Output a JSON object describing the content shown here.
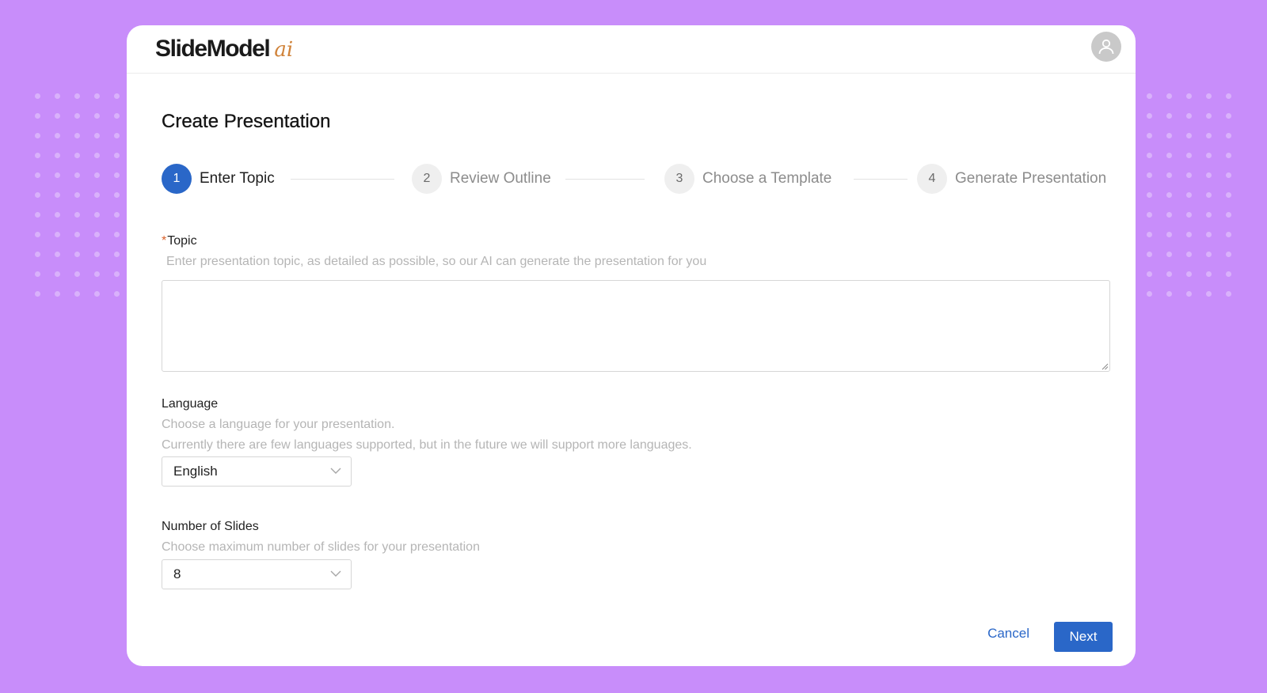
{
  "brand": {
    "name": "SlideModel",
    "suffix": "ai"
  },
  "page": {
    "title": "Create Presentation"
  },
  "stepper": {
    "steps": [
      {
        "number": "1",
        "label": "Enter Topic",
        "active": true
      },
      {
        "number": "2",
        "label": "Review Outline",
        "active": false
      },
      {
        "number": "3",
        "label": "Choose a Template",
        "active": false
      },
      {
        "number": "4",
        "label": "Generate Presentation",
        "active": false
      }
    ]
  },
  "form": {
    "topic": {
      "required_mark": "*",
      "label": "Topic",
      "help": "Enter presentation topic, as detailed as possible, so our AI can generate the presentation for you",
      "value": ""
    },
    "language": {
      "label": "Language",
      "help_line1": "Choose a language for your presentation.",
      "help_line2": "Currently there are few languages supported, but in the future we will support more languages.",
      "selected": "English"
    },
    "slides": {
      "label": "Number of Slides",
      "help": "Choose maximum number of slides for your presentation",
      "selected": "8"
    }
  },
  "actions": {
    "cancel_label": "Cancel",
    "next_label": "Next"
  },
  "icons": {
    "avatar": "user-icon",
    "select_arrow": "chevron-down-icon"
  },
  "colors": {
    "background": "#c88dfa",
    "accent": "#2a67c8",
    "logo_ai": "#d0833a",
    "required": "#d9622b"
  }
}
